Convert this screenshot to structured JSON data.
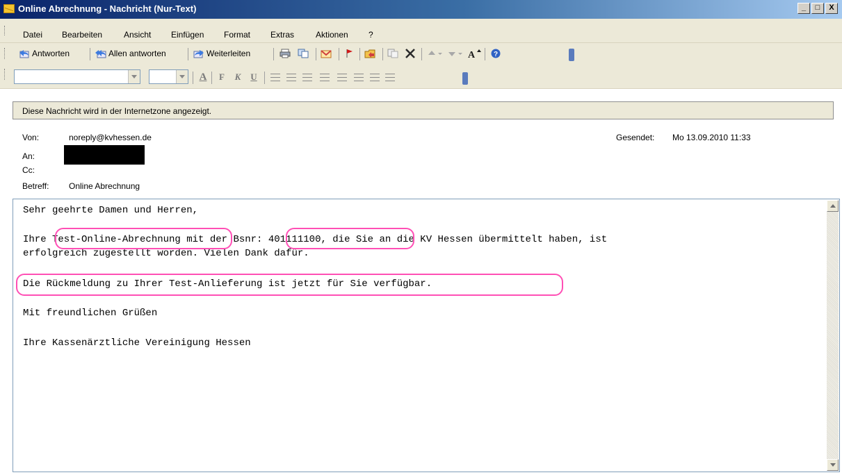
{
  "window": {
    "title": "Online Abrechnung - Nachricht (Nur-Text)",
    "minimize": "_",
    "maximize": "□",
    "close": "X"
  },
  "menu": [
    "Datei",
    "Bearbeiten",
    "Ansicht",
    "Einfügen",
    "Format",
    "Extras",
    "Aktionen",
    "?"
  ],
  "toolbar": {
    "reply": "Antworten",
    "reply_all": "Allen antworten",
    "forward": "Weiterleiten",
    "font_size_glyph": "A",
    "bold_glyph": "F",
    "italic_glyph": "K",
    "underline_glyph": "U"
  },
  "infobar": "Diese Nachricht wird in der Internetzone angezeigt.",
  "header": {
    "from_label": "Von:",
    "from_value": "noreply@kvhessen.de",
    "to_label": "An:",
    "cc_label": "Cc:",
    "subject_label": "Betreff:",
    "subject_value": "Online Abrechnung",
    "sent_label": "Gesendet:",
    "sent_value": "Mo 13.09.2010 11:33"
  },
  "body": {
    "greeting": "Sehr geehrte Damen und Herren,",
    "line1": "Ihre Test-Online-Abrechnung mit der Bsnr: 401111100, die Sie an die KV Hessen übermittelt haben, ist",
    "line2": "erfolgreich zugestellt worden. Vielen Dank dafür.",
    "line3": "Die Rückmeldung zu Ihrer Test-Anlieferung ist jetzt für Sie verfügbar.",
    "closing": "Mit freundlichen Grüßen",
    "signature": "Ihre Kassenärztliche Vereinigung Hessen"
  },
  "colors": {
    "highlight": "#ff4fb5",
    "chrome": "#ece9d8",
    "titlebar": "#0a246a"
  }
}
